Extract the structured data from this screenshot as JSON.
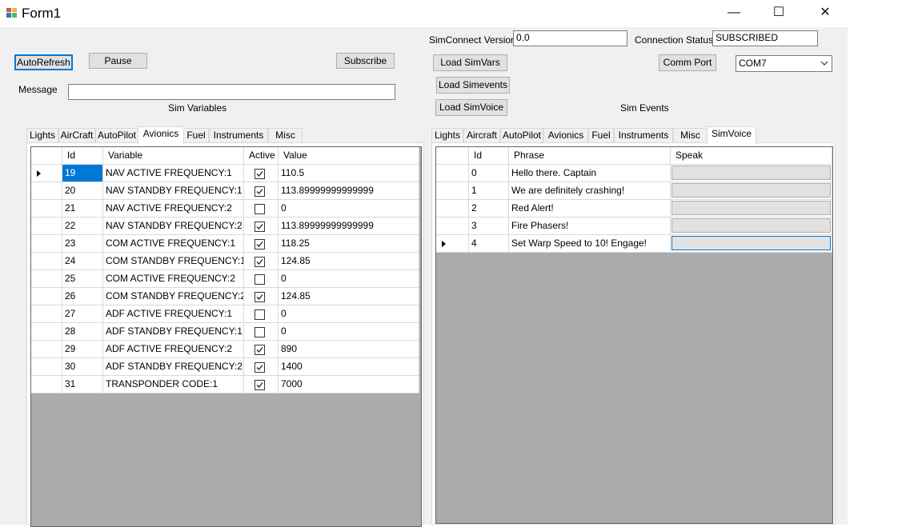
{
  "window": {
    "title": "Form1",
    "min_glyph": "—",
    "max_glyph": "☐",
    "close_glyph": "✕"
  },
  "toolbar": {
    "autorefresh": "AutoRefresh",
    "pause": "Pause",
    "subscribe": "Subscribe",
    "load_simvars": "Load SimVars",
    "load_simevents": "Load Simevents",
    "load_simvoice": "Load SimVoice",
    "comm_port": "Comm Port"
  },
  "status": {
    "simconnect_version_label": "SimConnect Version",
    "simconnect_version_value": "0.0",
    "connection_status_label": "Connection Status",
    "connection_status_value": "SUBSCRIBED",
    "message_label": "Message",
    "message_value": "",
    "com_port_selected": "COM7"
  },
  "sections": {
    "sim_variables": "Sim Variables",
    "sim_events": "Sim Events"
  },
  "left_tabs": [
    "Lights",
    "AirCraft",
    "AutoPilot",
    "Avionics",
    "Fuel",
    "Instruments",
    "Misc"
  ],
  "left_tab_selected": "Avionics",
  "right_tabs": [
    "Lights",
    "Aircraft",
    "AutoPilot",
    "Avionics",
    "Fuel",
    "Instruments",
    "Misc",
    "SimVoice"
  ],
  "right_tab_selected": "SimVoice",
  "vars_grid": {
    "headers": [
      "Id",
      "Variable",
      "Active",
      "Value"
    ],
    "rows": [
      {
        "id": "19",
        "variable": "NAV ACTIVE FREQUENCY:1",
        "active": true,
        "value": "110.5"
      },
      {
        "id": "20",
        "variable": "NAV STANDBY FREQUENCY:1",
        "active": true,
        "value": "113.89999999999999"
      },
      {
        "id": "21",
        "variable": "NAV ACTIVE FREQUENCY:2",
        "active": false,
        "value": "0"
      },
      {
        "id": "22",
        "variable": "NAV STANDBY FREQUENCY:2",
        "active": true,
        "value": "113.89999999999999"
      },
      {
        "id": "23",
        "variable": "COM ACTIVE FREQUENCY:1",
        "active": true,
        "value": "118.25"
      },
      {
        "id": "24",
        "variable": "COM STANDBY FREQUENCY:1",
        "active": true,
        "value": "124.85"
      },
      {
        "id": "25",
        "variable": "COM ACTIVE FREQUENCY:2",
        "active": false,
        "value": "0"
      },
      {
        "id": "26",
        "variable": "COM STANDBY FREQUENCY:2",
        "active": true,
        "value": "124.85"
      },
      {
        "id": "27",
        "variable": "ADF ACTIVE FREQUENCY:1",
        "active": false,
        "value": "0"
      },
      {
        "id": "28",
        "variable": "ADF STANDBY FREQUENCY:1",
        "active": false,
        "value": "0"
      },
      {
        "id": "29",
        "variable": "ADF ACTIVE FREQUENCY:2",
        "active": true,
        "value": "890"
      },
      {
        "id": "30",
        "variable": "ADF STANDBY FREQUENCY:2",
        "active": true,
        "value": "1400"
      },
      {
        "id": "31",
        "variable": "TRANSPONDER CODE:1",
        "active": true,
        "value": "7000"
      }
    ]
  },
  "voice_grid": {
    "headers": [
      "Id",
      "Phrase",
      "Speak"
    ],
    "rows": [
      {
        "id": "0",
        "phrase": "Hello there. Captain"
      },
      {
        "id": "1",
        "phrase": "We are definitely crashing!"
      },
      {
        "id": "2",
        "phrase": "Red Alert!"
      },
      {
        "id": "3",
        "phrase": "Fire Phasers!"
      },
      {
        "id": "4",
        "phrase": "Set Warp Speed to 10! Engage!"
      }
    ]
  },
  "colors": {
    "selection": "#0078d7",
    "grid_background": "#ababab",
    "form_background": "#f0f0f0"
  }
}
